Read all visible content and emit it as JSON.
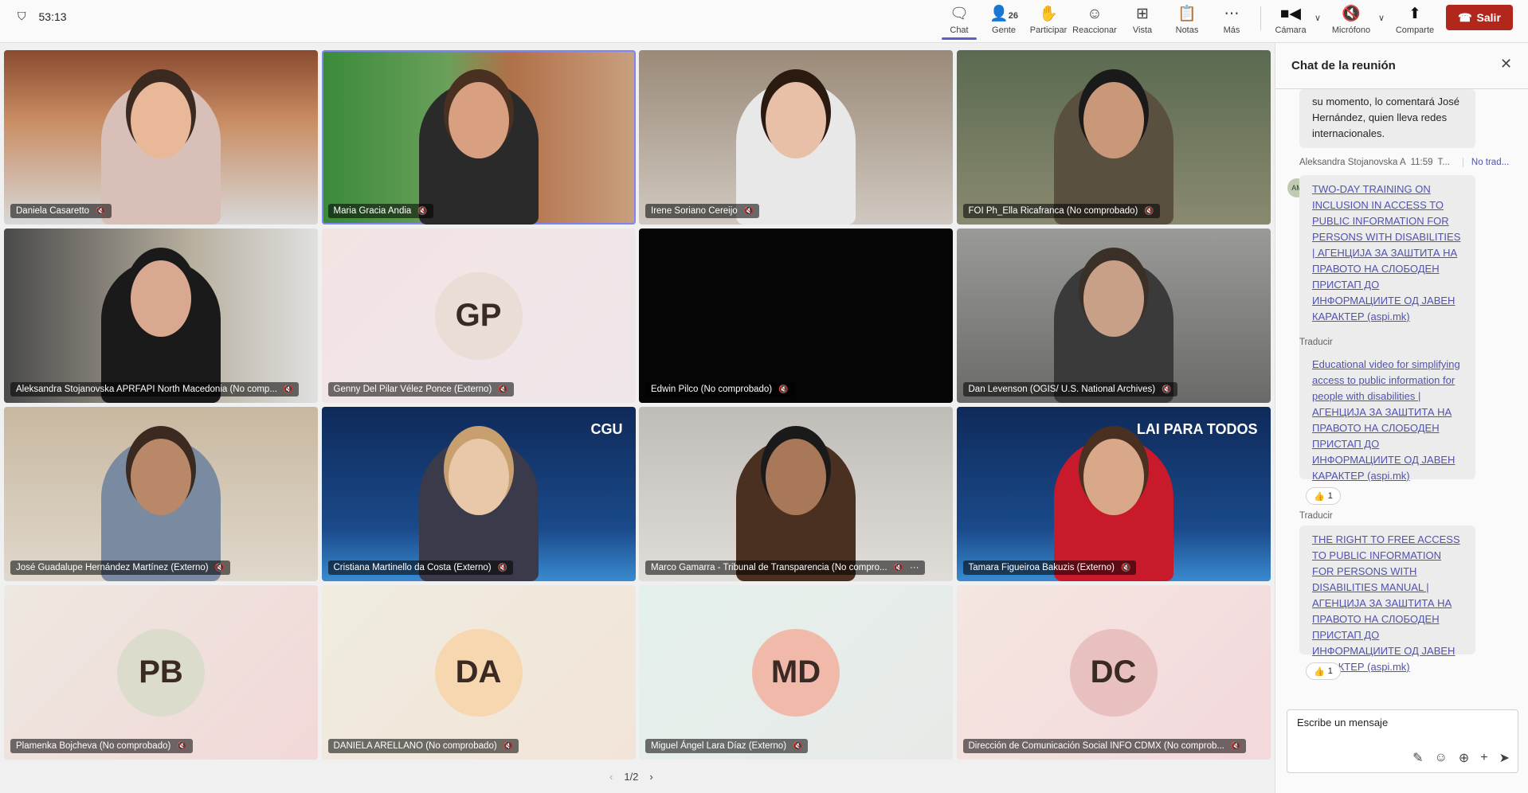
{
  "timer": {
    "icon": "shield-icon",
    "elapsed": "53:13"
  },
  "toolbar": {
    "chat": "Chat",
    "people": "Gente",
    "people_count": "26",
    "raise": "Participar",
    "react": "Reaccionar",
    "view": "Vista",
    "notes": "Notas",
    "more": "Más",
    "camera": "Cámara",
    "mic": "Micrófono",
    "share": "Comparte",
    "leave": "Salir"
  },
  "colors": {
    "accent": "#5b5fc7",
    "leave": "#b1271b",
    "link": "#4f52b2"
  },
  "tiles": [
    {
      "name": "Daniela Casaretto",
      "type": "video"
    },
    {
      "name": "Maria Gracia Andia",
      "type": "video",
      "speaking": true
    },
    {
      "name": "Irene Soriano Cereijo",
      "type": "video"
    },
    {
      "name": "FOI Ph_Ella Ricafranca (No comprobado)",
      "type": "video"
    },
    {
      "name": "Aleksandra Stojanovska APRFAPI North Macedonia (No comp...",
      "type": "video"
    },
    {
      "name": "Genny Del Pilar Vélez Ponce (Externo)",
      "type": "avatar",
      "initials": "GP"
    },
    {
      "name": "Edwin Pilco (No comprobado)",
      "type": "dark"
    },
    {
      "name": "Dan Levenson (OGIS/ U.S. National Archives)",
      "type": "video"
    },
    {
      "name": "José Guadalupe Hernández Martínez (Externo)",
      "type": "video"
    },
    {
      "name": "Cristiana Martinello da Costa (Externo)",
      "type": "video",
      "overlay": "CGU"
    },
    {
      "name": "Marco Gamarra - Tribunal de Transparencia (No compro...",
      "type": "video",
      "more": "···"
    },
    {
      "name": "Tamara Figueiroa Bakuzis (Externo)",
      "type": "video",
      "overlay": "LAI PARA TODOS"
    },
    {
      "name": "Plamenka Bojcheva (No comprobado)",
      "type": "avatar",
      "initials": "PB"
    },
    {
      "name": "DANIELA ARELLANO (No comprobado)",
      "type": "avatar",
      "initials": "DA"
    },
    {
      "name": "Miguel Ángel Lara Díaz (Externo)",
      "type": "avatar",
      "initials": "MD"
    },
    {
      "name": "Dirección de Comunicación Social INFO CDMX (No comprob...",
      "type": "avatar",
      "initials": "DC"
    }
  ],
  "pager": {
    "page": "1/2"
  },
  "chat": {
    "title": "Chat de la reunión",
    "msg0": "su momento, lo comentará José Hernández, quien lleva redes internacionales.",
    "sender": "Aleksandra Stojanovska A",
    "time": "11:59",
    "translate_short": "T...",
    "not_translated": "No trad...",
    "sender_initials": "AM",
    "msg1": "TWO-DAY TRAINING ON INCLUSION IN ACCESS TO PUBLIC INFORMATION FOR PERSONS WITH DISABILITIES | АГЕНЦИЈА ЗА ЗАШТИТА НА ПРАВОТО НА СЛОБОДЕН ПРИСТАП ДО ИНФОРМАЦИИТЕ ОД ЈАВЕН КАРАКТЕР (aspi.mk)",
    "translate": "Traducir",
    "msg2": "Educational video for simplifying access to public information for people with disabilities | АГЕНЦИЈА ЗА ЗАШТИТА НА ПРАВОТО НА СЛОБОДЕН ПРИСТАП ДО ИНФОРМАЦИИТЕ ОД ЈАВЕН КАРАКТЕР (aspi.mk)",
    "msg2_reaction": "1",
    "msg3": "THE RIGHT TO FREE ACCESS TO PUBLIC INFORMATION FOR PERSONS WITH DISABILITIES MANUAL | АГЕНЦИЈА ЗА ЗАШТИТА НА ПРАВОТО НА СЛОБОДЕН ПРИСТАП ДО ИНФОРМАЦИИТЕ ОД ЈАВЕН КАРАКТЕР (aspi.mk)",
    "msg3_reaction": "1",
    "compose_placeholder": "Escribe un mensaje"
  }
}
